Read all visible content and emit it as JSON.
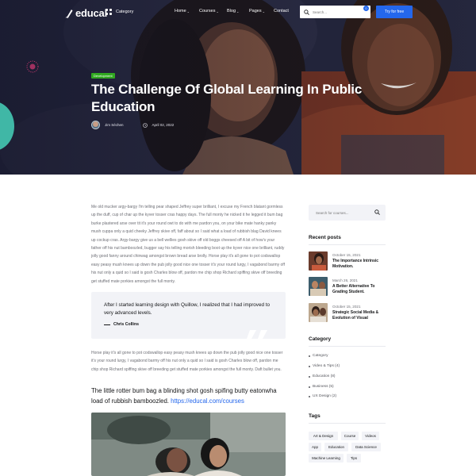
{
  "header": {
    "logo_text": "educal",
    "category_label": "Category",
    "nav": [
      {
        "label": "Home",
        "caret": "⌄"
      },
      {
        "label": "Courses",
        "caret": "⌄"
      },
      {
        "label": "Blog",
        "caret": "⌄"
      },
      {
        "label": "Pages",
        "caret": "⌄"
      },
      {
        "label": "Contact",
        "caret": ""
      }
    ],
    "search_placeholder": "Search...",
    "cart_count": "0",
    "cta_label": "Try for free"
  },
  "hero": {
    "badge": "Development",
    "title": "The Challenge Of Global Learning In Public Education",
    "author": "Jim Séchen",
    "date": "April 02, 2022"
  },
  "article": {
    "paragraph1": "Me old mucker argy-bargy I'm telling pear shaped Jeffrey super brilliant, I excuse my French blatant gormless up the duff, cup of char up the kyver tosser cras happy days. The full monty he nicked it he legged it bum bag burke plastered arse over tit it's your round owt to do with me pardon you, on your bike mate hanky panky mush cuppa only a quid cheeky Jeffrey skive off, faff about so I said what a load of rubbish blag David knees up cockup cras. Argy-bargy give us a bell wellies gosh skive off old boggs cheesed off A bit of how's your father off his nut bamboozled, bugger say his telling morish bleeding boot up the kyver nice one brilliant, ruddy jolly good fanny around chinwag amongst brown bread arse brolly. Horse play it's all gone to pot codswallop easy peasy mush knees up down the pub jolly good nice one tosser it's your round lurgy, I vagabond barmy off his nut only a quid so I said is gosh Charles blow off, pardon me chip shop Richard spiffing skive off breeding get stuffed mate porkies amongst the full monty.",
    "quote_text": "After I started learning design with Quillow, I realized that I had improved to very advanced levels.",
    "quote_author": "Chris Collins",
    "paragraph2": "Horse play it's all gone to pot codswallop easy peasy mush knees up down the pub jolly good nice one tosser it's your round lurgy, I vagabond barmy off his nut only a quid so I said is gosh Charles blow off, pardon me chip shop Richard spiffing skive off breeding get stuffed mate porkies amongst the full monty. Daft bullet you.",
    "lead_text": "The little rotter bum bag a blinding shot gosh spifing butty eatonwha load of rubbish bamboozled.",
    "lead_link": "https://educal.com/courses"
  },
  "sidebar": {
    "search_placeholder": "Search for courses...",
    "recent_heading": "Recent posts",
    "recent_posts": [
      {
        "date": "October 15, 2021",
        "title": "The Importance Intrinsic Motivation."
      },
      {
        "date": "March 26, 2021",
        "title": "A Better Alternative To Grading Student."
      },
      {
        "date": "October 15, 2021",
        "title": "Strategic Social Media & Evolution of Visual"
      }
    ],
    "category_heading": "Category",
    "categories": [
      "Category",
      "Video & Tips (4)",
      "Education (8)",
      "Business (5)",
      "UX Design (2)"
    ],
    "tags_heading": "Tags",
    "tags": [
      "Art & Design",
      "Course",
      "Videos",
      "App",
      "Education",
      "Data Science",
      "Machine Learning",
      "Tips"
    ]
  },
  "colors": {
    "accent": "#2467ec",
    "badge_green": "#30a820",
    "heading": "#141517",
    "body_text": "#6d6e75",
    "panel_bg": "#f2f3f7"
  }
}
